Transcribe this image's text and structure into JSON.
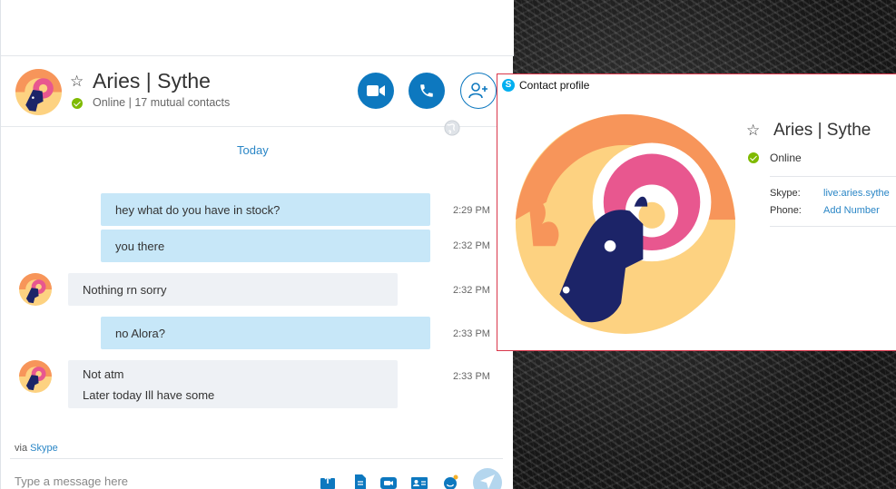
{
  "contact": {
    "name": "Aries | Sythe",
    "status": "Online",
    "mutual": "17 mutual contacts"
  },
  "conversation": {
    "date_divider": "Today",
    "messages": [
      {
        "direction": "out",
        "text": "hey what do you have in stock?",
        "time": "2:29 PM"
      },
      {
        "direction": "out",
        "text": "you there",
        "time": "2:32 PM"
      },
      {
        "direction": "in",
        "text": "Nothing rn sorry",
        "time": "2:32 PM"
      },
      {
        "direction": "out",
        "text": "no Alora?",
        "time": "2:33 PM"
      },
      {
        "direction": "in",
        "lines": [
          "Not atm",
          "Later today Ill have some"
        ],
        "time": "2:33 PM"
      }
    ]
  },
  "composer": {
    "via_prefix": "via",
    "via_link": "Skype",
    "placeholder": "Type a message here"
  },
  "profile": {
    "title": "Contact profile",
    "skype_label": "Skype:",
    "skype_value": "live:aries.sythe",
    "phone_label": "Phone:",
    "phone_value": "Add Number"
  },
  "icons": {
    "header_actions": [
      "video-call-icon",
      "phone-call-icon",
      "add-contact-icon"
    ],
    "composer_tools": [
      "send-file-icon",
      "document-icon",
      "video-message-icon",
      "contact-card-icon",
      "emoji-icon",
      "send-icon"
    ]
  },
  "colors": {
    "accent": "#0d78bf",
    "online": "#7fba00",
    "outgoing_bubble": "#c7e7f8",
    "incoming_bubble": "#eef1f5",
    "avatar_orange": "#f7955a",
    "avatar_yellow": "#fdd281",
    "avatar_pink": "#e8578f",
    "avatar_navy": "#1c2468",
    "popup_border": "#d9364a"
  }
}
